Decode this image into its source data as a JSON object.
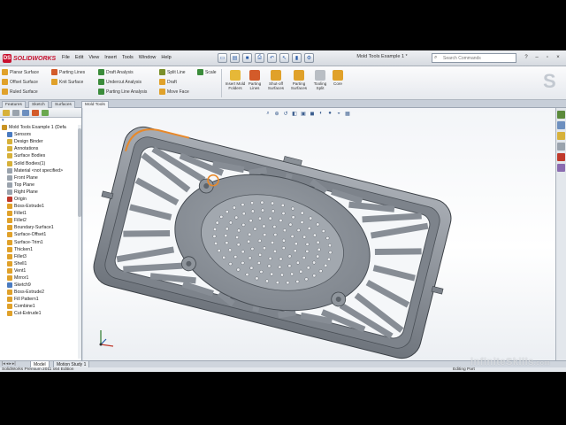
{
  "app": {
    "brand": "SOLIDWORKS",
    "document_title": "Mold Tools Example 1 *",
    "search_placeholder": "Search Commands"
  },
  "menus": [
    "File",
    "Edit",
    "View",
    "Insert",
    "Tools",
    "Window",
    "Help"
  ],
  "quick_tools": [
    "new-icon",
    "open-icon",
    "save-icon",
    "print-icon",
    "undo-icon",
    "select-icon",
    "rebuild-icon",
    "options-icon"
  ],
  "command_manager": {
    "small_commands": [
      {
        "label": "Planar Surface",
        "color": "#e0a12a"
      },
      {
        "label": "Offset Surface",
        "color": "#e0a12a"
      },
      {
        "label": "Ruled Surface",
        "color": "#e0a12a"
      },
      {
        "label": "Parting Lines",
        "color": "#d35b2a"
      },
      {
        "label": "Knit Surface",
        "color": "#e0a12a"
      },
      {
        "label": "Draft Analysis",
        "color": "#3b8c3b"
      },
      {
        "label": "Undercut Analysis",
        "color": "#3b8c3b"
      },
      {
        "label": "Parting Line Analysis",
        "color": "#3b8c3b"
      },
      {
        "label": "Split Line",
        "color": "#7a8f2a"
      },
      {
        "label": "Draft",
        "color": "#e0a12a"
      },
      {
        "label": "Move Face",
        "color": "#e0a12a"
      },
      {
        "label": "Scale",
        "color": "#3b8c3b"
      }
    ],
    "big_commands": [
      {
        "label": "Insert Mold Folders",
        "color": "#e6b838"
      },
      {
        "label": "Parting Lines",
        "color": "#d35b2a"
      },
      {
        "label": "Shut-off Surfaces",
        "color": "#e0a12a"
      },
      {
        "label": "Parting Surfaces",
        "color": "#e0a12a"
      },
      {
        "label": "Tooling Split",
        "color": "#b9bec4"
      },
      {
        "label": "Core",
        "color": "#e0a12a"
      }
    ]
  },
  "command_tabs": [
    "Features",
    "Sketch",
    "Surfaces",
    "Mold Tools"
  ],
  "active_command_tab": "Mold Tools",
  "panel_icons": [
    "feature-manager-icon",
    "property-manager-icon",
    "configuration-manager-icon",
    "dimxpert-icon",
    "display-manager-icon"
  ],
  "feature_tree": {
    "root": "Mold Tools Example 1 (Defa",
    "items": [
      {
        "label": "Sensors",
        "color": "#4a7bc0"
      },
      {
        "label": "Design Binder",
        "color": "#d7b13a"
      },
      {
        "label": "Annotations",
        "color": "#d7b13a"
      },
      {
        "label": "Surface Bodies",
        "color": "#d7b13a"
      },
      {
        "label": "Solid Bodies(1)",
        "color": "#d7b13a"
      },
      {
        "label": "Material <not specified>",
        "color": "#9aa3ad"
      },
      {
        "label": "Front Plane",
        "color": "#9aa3ad"
      },
      {
        "label": "Top Plane",
        "color": "#9aa3ad"
      },
      {
        "label": "Right Plane",
        "color": "#9aa3ad"
      },
      {
        "label": "Origin",
        "color": "#c0392b"
      },
      {
        "label": "Boss-Extrude1",
        "color": "#e0a12a"
      },
      {
        "label": "Fillet1",
        "color": "#e0a12a"
      },
      {
        "label": "Fillet2",
        "color": "#e0a12a"
      },
      {
        "label": "Boundary-Surface1",
        "color": "#e0a12a"
      },
      {
        "label": "Surface-Offset1",
        "color": "#e0a12a"
      },
      {
        "label": "Surface-Trim1",
        "color": "#e0a12a"
      },
      {
        "label": "Thicken1",
        "color": "#e0a12a"
      },
      {
        "label": "Fillet3",
        "color": "#e0a12a"
      },
      {
        "label": "Shell1",
        "color": "#e0a12a"
      },
      {
        "label": "Vent1",
        "color": "#e0a12a"
      },
      {
        "label": "Mirror1",
        "color": "#e0a12a"
      },
      {
        "label": "Sketch9",
        "color": "#4a7bc0"
      },
      {
        "label": "Boss-Extrude2",
        "color": "#e0a12a"
      },
      {
        "label": "Fill Pattern1",
        "color": "#e0a12a"
      },
      {
        "label": "Combine1",
        "color": "#e0a12a"
      },
      {
        "label": "Cut-Extrude1",
        "color": "#e0a12a"
      }
    ]
  },
  "headsup_icons": [
    "zoom-to-fit-icon",
    "zoom-area-icon",
    "previous-view-icon",
    "section-view-icon",
    "view-orientation-icon",
    "display-style-icon",
    "hide-show-icon",
    "edit-appearance-icon",
    "scene-icon",
    "view-settings-icon"
  ],
  "task_pane_icons": [
    "resources-icon",
    "design-library-icon",
    "file-explorer-icon",
    "view-palette-icon",
    "appearances-icon",
    "custom-properties-icon"
  ],
  "bottom_tabs": [
    "Model",
    "Motion Study 1"
  ],
  "active_bottom_tab": "Model",
  "status": {
    "left": "SolidWorks Premium 2011 x64 Edition",
    "mid": "Editing Part"
  },
  "watermark": {
    "main": "infiniteSkills",
    "suffix": ".com"
  },
  "colors": {
    "part_body": "#8e949c",
    "selected_edge": "#e8892a",
    "viewport_bg": "#f3f5f8"
  }
}
